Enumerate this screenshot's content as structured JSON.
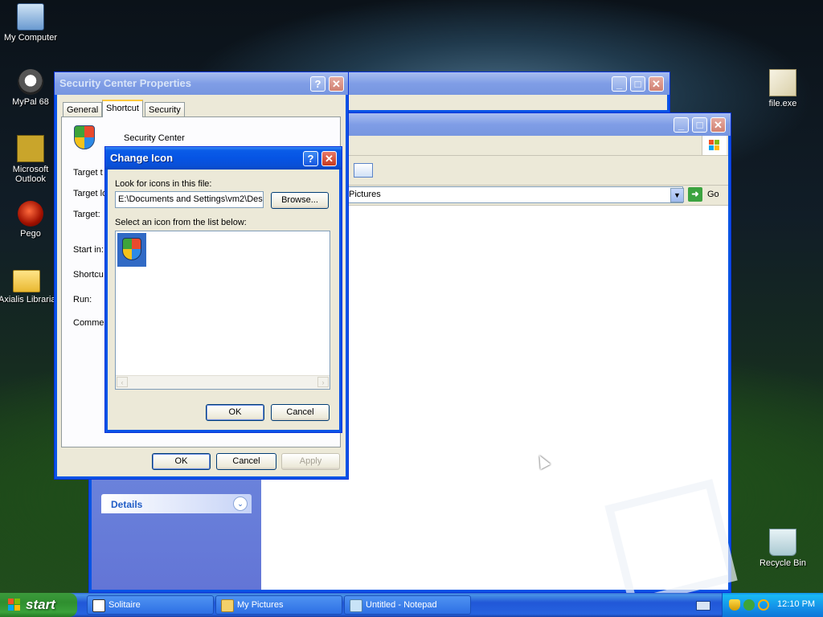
{
  "desktop": {
    "icons": [
      {
        "label": "My Computer",
        "icon": "my-computer-icon"
      },
      {
        "label": "MyPal 68",
        "icon": "mypal-icon"
      },
      {
        "label": "Microsoft Outlook",
        "icon": "outlook-icon"
      },
      {
        "label": "Pego",
        "icon": "pego-icon"
      },
      {
        "label": "Axialis Librarian",
        "icon": "folder-icon"
      },
      {
        "label": "file.exe",
        "icon": "file-exe-icon"
      },
      {
        "label": "Recycle Bin",
        "icon": "recycle-bin-icon"
      }
    ]
  },
  "explorer": {
    "address_value": "Pictures",
    "go_label": "Go",
    "details_label": "Details"
  },
  "properties": {
    "title": "Security Center Properties",
    "tabs": [
      "General",
      "Shortcut",
      "Security"
    ],
    "app_name": "Security Center",
    "labels": [
      "Target t",
      "Target lo",
      "Target:",
      "Start in:",
      "Shortcu",
      "Run:",
      "Commer"
    ],
    "ok_label": "OK",
    "cancel_label": "Cancel",
    "apply_label": "Apply"
  },
  "change_icon": {
    "title": "Change Icon",
    "look_label": "Look for icons in this file:",
    "path_value": "E:\\Documents and Settings\\vm2\\Des",
    "browse_label": "Browse...",
    "select_label": "Select an icon from the list below:",
    "ok_label": "OK",
    "cancel_label": "Cancel"
  },
  "taskbar": {
    "start_label": "start",
    "items": [
      {
        "label": "Solitaire"
      },
      {
        "label": "My Pictures"
      },
      {
        "label": "Untitled - Notepad"
      }
    ],
    "clock": "12:10 PM"
  },
  "colors": {
    "xp_blue": "#0a54e6",
    "start_green": "#3c9a3c",
    "dialog_face": "#ece9d8"
  }
}
